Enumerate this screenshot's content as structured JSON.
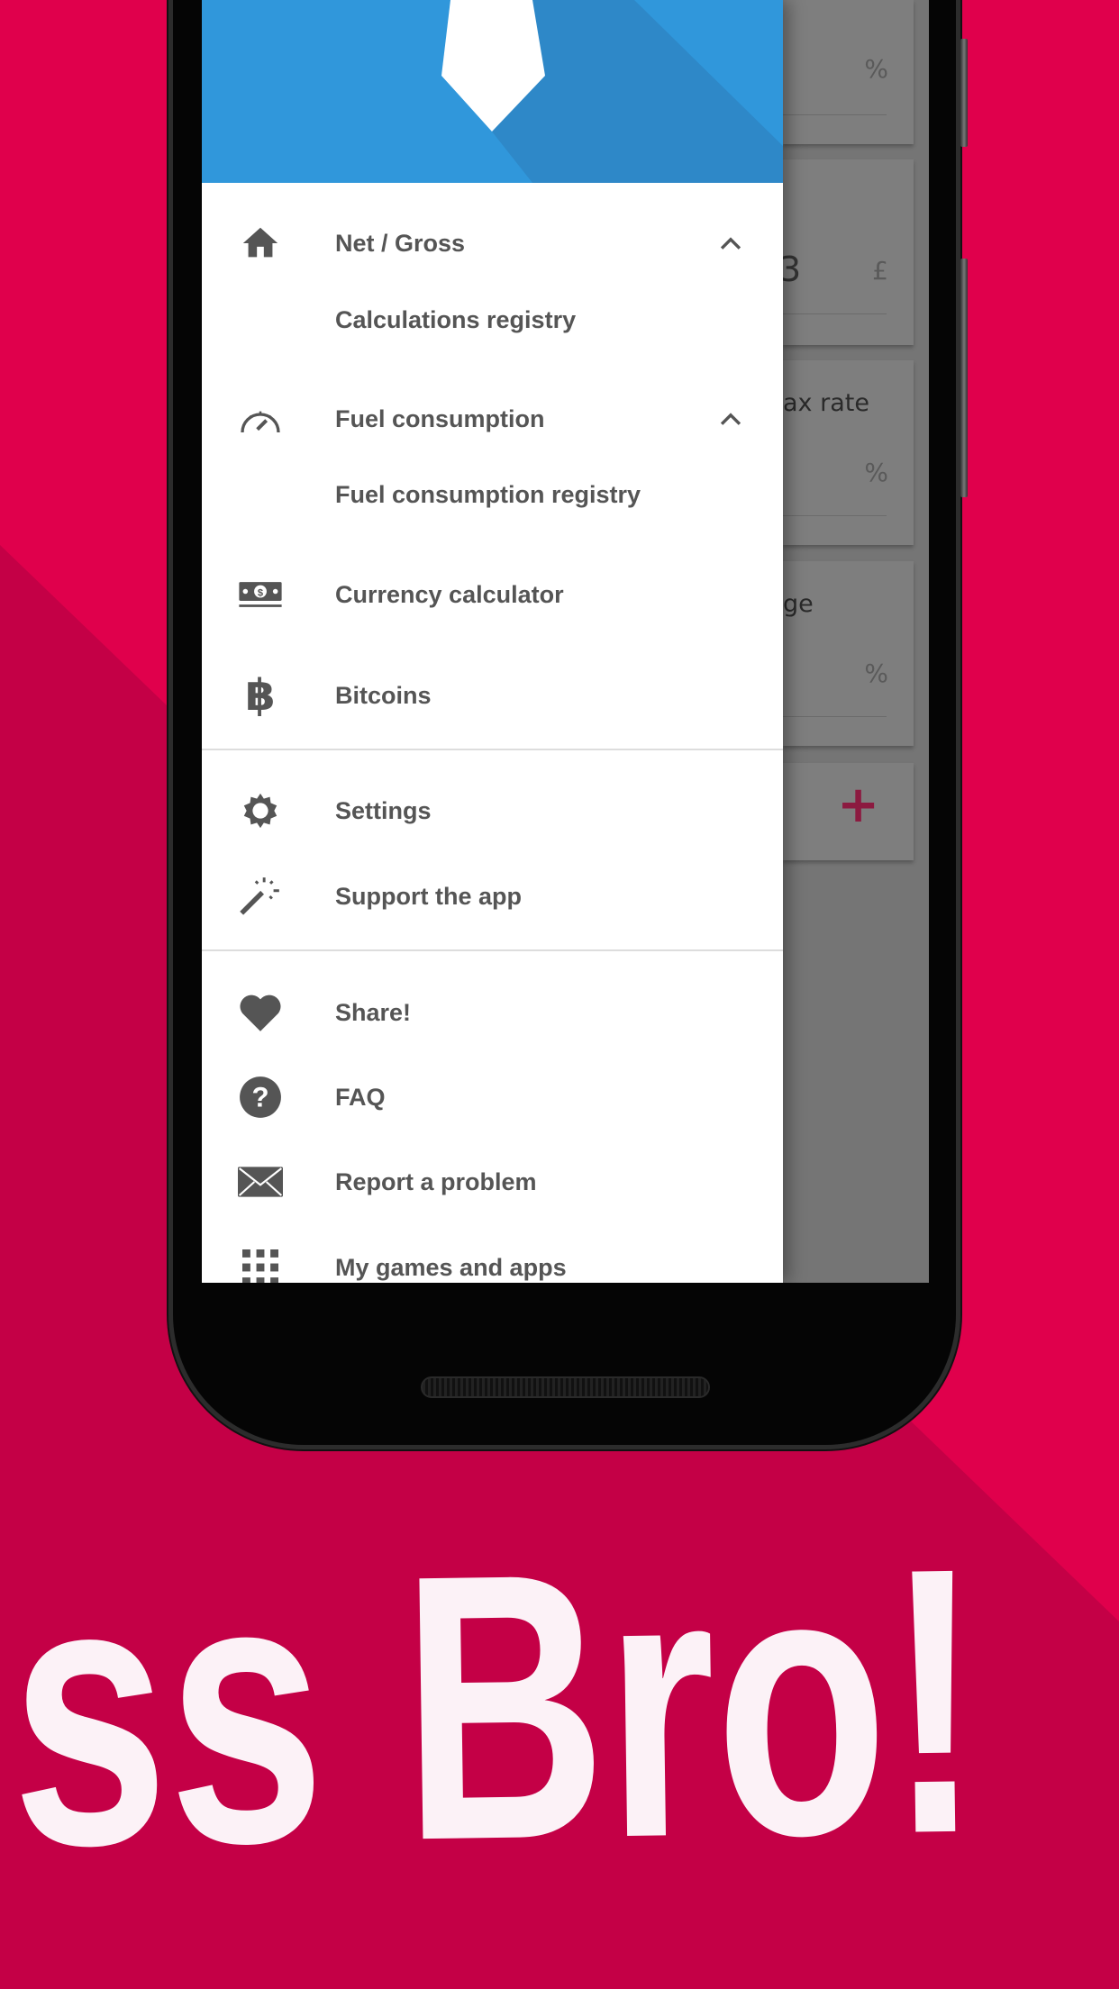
{
  "colors": {
    "background": "#e0004c",
    "background_dark": "#c40046",
    "header_blue": "#3097db",
    "icon_gray": "#555555",
    "accent_plus": "#8c1a40"
  },
  "slogan": "ss Bro!",
  "background_app": {
    "card1_unit": "%",
    "card2_value": "3",
    "card2_unit": "£",
    "card3_label": "ax rate",
    "card3_unit": "%",
    "card4_label": "ge",
    "card4_unit": "%",
    "add_symbol": "+"
  },
  "drawer": {
    "items": [
      {
        "label": "Net / Gross",
        "icon": "home-icon",
        "expanded": true
      },
      {
        "label": "Calculations registry"
      },
      {
        "label": "Fuel consumption",
        "icon": "speedometer-icon",
        "expanded": true
      },
      {
        "label": "Fuel consumption registry"
      },
      {
        "label": "Currency calculator",
        "icon": "banknote-icon"
      },
      {
        "label": "Bitcoins",
        "icon": "bitcoin-icon"
      },
      {
        "label": "Settings",
        "icon": "gear-icon"
      },
      {
        "label": "Support the app",
        "icon": "magic-wand-icon"
      },
      {
        "label": "Share!",
        "icon": "heart-icon"
      },
      {
        "label": "FAQ",
        "icon": "help-circle-icon"
      },
      {
        "label": "Report a problem",
        "icon": "envelope-icon"
      },
      {
        "label": "My games and apps",
        "icon": "grid-icon"
      }
    ]
  }
}
